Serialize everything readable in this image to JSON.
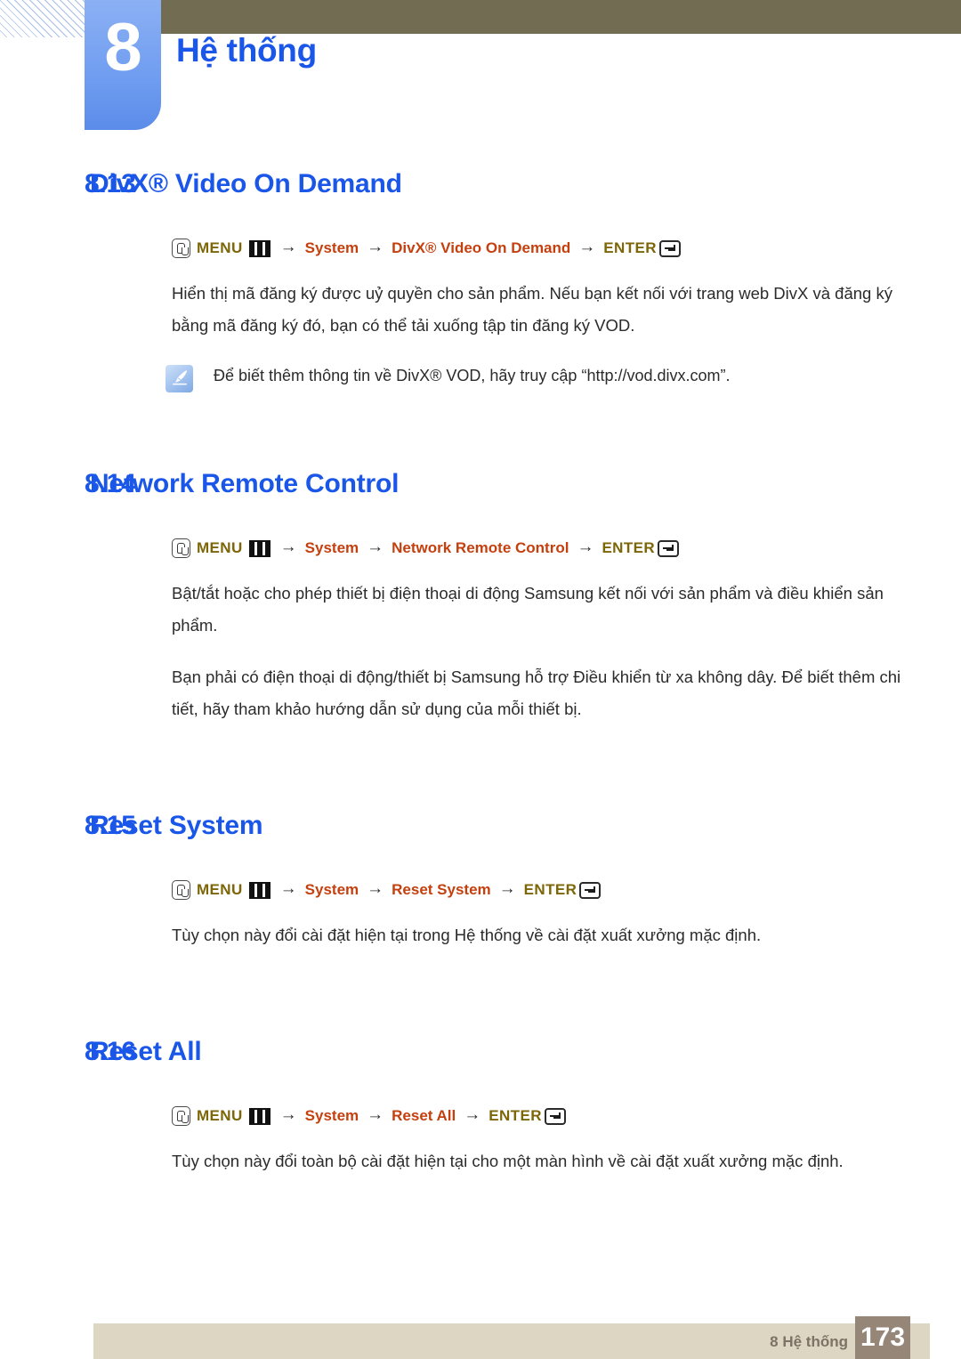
{
  "header": {
    "chapter_number": "8",
    "chapter_title": "Hệ thống",
    "accent_blue": "#1a56e8",
    "olive_bar": "#726c53",
    "badge_blue": "#6e9cf0"
  },
  "breadcrumb_common": {
    "menu_label": "MENU",
    "enter_label": "ENTER",
    "arrow": "→",
    "system_label": "System",
    "menu_color": "#7d6608",
    "path_color": "#c4400f"
  },
  "sections": [
    {
      "number": "8.13",
      "title": "DivX® Video On Demand",
      "breadcrumb_target": "DivX® Video On Demand",
      "paragraph": "Hiển thị mã đăng ký được uỷ quyền cho sản phẩm. Nếu bạn kết nối với trang web DivX và đăng ký bằng mã đăng ký đó, bạn có thể tải xuống tập tin đăng ký VOD.",
      "note": "Để biết thêm thông tin về DivX® VOD, hãy truy cập “http://vod.divx.com”."
    },
    {
      "number": "8.14",
      "title": "Network Remote Control",
      "breadcrumb_target": "Network Remote Control",
      "paragraph": "Bật/tắt hoặc cho phép thiết bị điện thoại di động Samsung kết nối với sản phẩm và điều khiển sản phẩm.",
      "paragraph2": "Bạn phải có điện thoại di động/thiết bị Samsung hỗ trợ Điều khiển từ xa không dây. Để biết thêm chi tiết, hãy tham khảo hướng dẫn sử dụng của mỗi thiết bị."
    },
    {
      "number": "8.15",
      "title": "Reset System",
      "breadcrumb_target": "Reset System",
      "paragraph": "Tùy chọn này đổi cài đặt hiện tại trong Hệ thống về cài đặt xuất xưởng mặc định."
    },
    {
      "number": "8.16",
      "title": "Reset All",
      "breadcrumb_target": "Reset All",
      "paragraph": "Tùy chọn này đổi toàn bộ cài đặt hiện tại cho một màn hình về cài đặt xuất xưởng mặc định."
    }
  ],
  "footer": {
    "label": "8 Hệ thống",
    "page_number": "173",
    "bar_color": "#ddd6c2",
    "pagebox_color": "#968678"
  }
}
